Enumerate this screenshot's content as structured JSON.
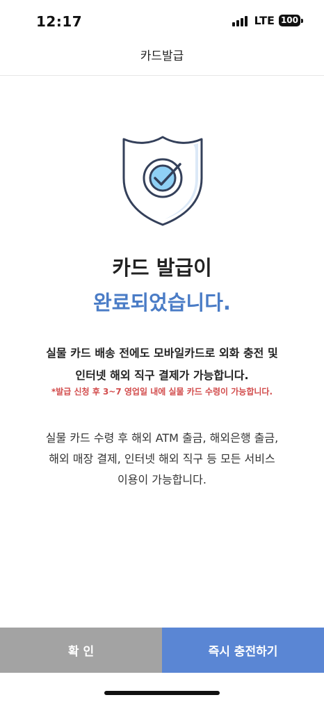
{
  "status_bar": {
    "time": "12:17",
    "network": "LTE",
    "battery": "100"
  },
  "header": {
    "title": "카드발급"
  },
  "icons": {
    "shield": "shield-check-icon",
    "signal": "signal-bars-icon",
    "battery": "battery-icon"
  },
  "main": {
    "title_line1": "카드 발급이",
    "title_line2": "완료되었습니다.",
    "desc_line1": "실물 카드 배송 전에도 모바일카드로 외화 충전 및",
    "desc_line2": "인터넷 해외 직구 결제가 가능합니다.",
    "notice": "*발급 신청 후 3~7 영업일 내에 실물 카드 수령이 가능합니다.",
    "info_line1": "실물 카드 수령 후 해외 ATM 출금, 해외은행 출금,",
    "info_line2": "해외 매장 결제, 인터넷 해외 직구 등 모든 서비스",
    "info_line3": "이용이 가능합니다."
  },
  "buttons": {
    "confirm": "확 인",
    "charge": "즉시 충전하기"
  },
  "colors": {
    "accent_blue": "#4a7cc6",
    "button_blue": "#5a86d4",
    "button_gray": "#a3a3a3",
    "notice_red": "#d24c4c"
  }
}
